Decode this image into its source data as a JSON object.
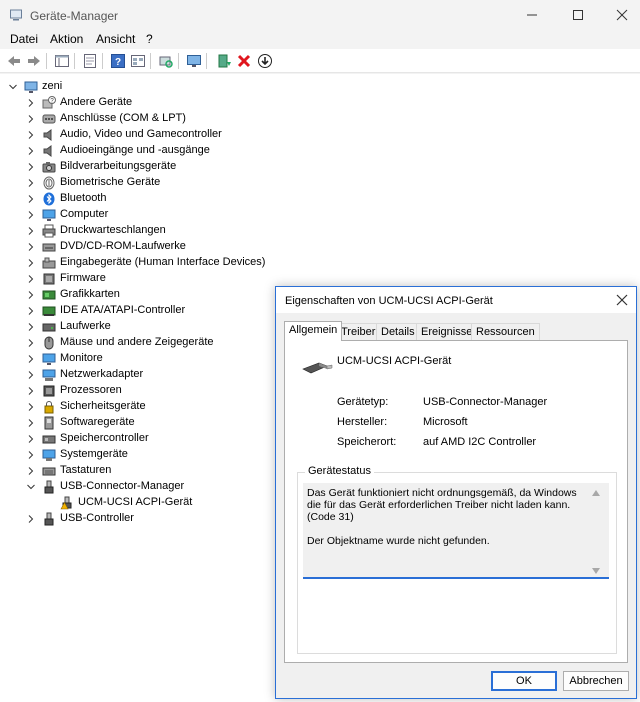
{
  "window": {
    "title": "Geräte-Manager"
  },
  "menu": {
    "items": [
      "Datei",
      "Aktion",
      "Ansicht",
      "?"
    ]
  },
  "tree": {
    "root": "zeni",
    "items": [
      {
        "label": "Andere Geräte",
        "icon": "unknown-device-icon",
        "expanded": false
      },
      {
        "label": "Anschlüsse (COM & LPT)",
        "icon": "port-icon",
        "expanded": false
      },
      {
        "label": "Audio, Video und Gamecontroller",
        "icon": "speaker-icon",
        "expanded": false
      },
      {
        "label": "Audioeingänge und -ausgänge",
        "icon": "speaker-icon",
        "expanded": false
      },
      {
        "label": "Bildverarbeitungsgeräte",
        "icon": "camera-icon",
        "expanded": false
      },
      {
        "label": "Biometrische Geräte",
        "icon": "fingerprint-icon",
        "expanded": false
      },
      {
        "label": "Bluetooth",
        "icon": "bluetooth-icon",
        "expanded": false
      },
      {
        "label": "Computer",
        "icon": "monitor-icon",
        "expanded": false
      },
      {
        "label": "Druckwarteschlangen",
        "icon": "printer-icon",
        "expanded": false
      },
      {
        "label": "DVD/CD-ROM-Laufwerke",
        "icon": "disc-drive-icon",
        "expanded": false
      },
      {
        "label": "Eingabegeräte (Human Interface Devices)",
        "icon": "hid-icon",
        "expanded": false
      },
      {
        "label": "Firmware",
        "icon": "firmware-icon",
        "expanded": false
      },
      {
        "label": "Grafikkarten",
        "icon": "graphics-card-icon",
        "expanded": false
      },
      {
        "label": "IDE ATA/ATAPI-Controller",
        "icon": "ide-controller-icon",
        "expanded": false
      },
      {
        "label": "Laufwerke",
        "icon": "drive-icon",
        "expanded": false
      },
      {
        "label": "Mäuse und andere Zeigegeräte",
        "icon": "mouse-icon",
        "expanded": false
      },
      {
        "label": "Monitore",
        "icon": "monitor-icon",
        "expanded": false
      },
      {
        "label": "Netzwerkadapter",
        "icon": "network-icon",
        "expanded": false
      },
      {
        "label": "Prozessoren",
        "icon": "cpu-icon",
        "expanded": false
      },
      {
        "label": "Sicherheitsgeräte",
        "icon": "security-icon",
        "expanded": false
      },
      {
        "label": "Softwaregeräte",
        "icon": "software-device-icon",
        "expanded": false
      },
      {
        "label": "Speichercontroller",
        "icon": "storage-controller-icon",
        "expanded": false
      },
      {
        "label": "Systemgeräte",
        "icon": "system-device-icon",
        "expanded": false
      },
      {
        "label": "Tastaturen",
        "icon": "keyboard-icon",
        "expanded": false
      },
      {
        "label": "USB-Connector-Manager",
        "icon": "usb-icon",
        "expanded": true
      },
      {
        "label": "UCM-UCSI ACPI-Gerät",
        "icon": "warning-usb-icon",
        "child": true
      },
      {
        "label": "USB-Controller",
        "icon": "usb-icon",
        "expanded": false
      }
    ]
  },
  "dialog": {
    "title": "Eigenschaften von UCM-UCSI ACPI-Gerät",
    "tabs": [
      "Allgemein",
      "Treiber",
      "Details",
      "Ereignisse",
      "Ressourcen"
    ],
    "active_tab": "Allgemein",
    "device_name": "UCM-UCSI ACPI-Gerät",
    "props": [
      {
        "label": "Gerätetyp:",
        "value": "USB-Connector-Manager"
      },
      {
        "label": "Hersteller:",
        "value": "Microsoft"
      },
      {
        "label": "Speicherort:",
        "value": "auf AMD I2C Controller"
      }
    ],
    "status_group_title": "Gerätestatus",
    "status_text": "Das Gerät funktioniert nicht ordnungsgemäß, da Windows die für das Gerät erforderlichen Treiber nicht laden kann. (Code 31)\n\nDer Objektname wurde nicht gefunden.",
    "ok_label": "OK",
    "cancel_label": "Abbrechen"
  },
  "colors": {
    "accent": "#2a6fd6",
    "warning": "#f2b200",
    "error": "#e0161e"
  }
}
